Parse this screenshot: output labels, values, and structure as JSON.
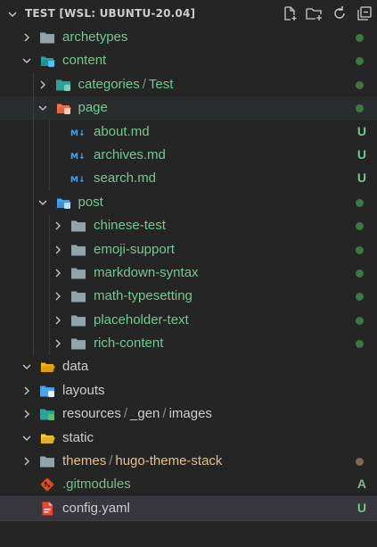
{
  "header": {
    "title": "TEST [WSL: UBUNTU-20.04]",
    "actions": [
      "new-file-icon",
      "new-folder-icon",
      "refresh-icon",
      "collapse-all-icon"
    ]
  },
  "colors": {
    "background": "#252526",
    "git_clean_dot": "#3b7a3f",
    "git_modified_dot": "#7d6a4f",
    "untracked_text": "#73c991",
    "added_badge": "#81b88b",
    "selected_row": "#37373d"
  },
  "tree": [
    {
      "label": "archetypes",
      "kind": "folder",
      "icon": "folder-icon",
      "depth": 0,
      "expanded": false,
      "status": "clean-dot"
    },
    {
      "label": "content",
      "kind": "folder",
      "icon": "folder-content-icon",
      "depth": 0,
      "expanded": true,
      "status": "clean-dot"
    },
    {
      "label": "categories",
      "label2": "Test",
      "kind": "folder",
      "icon": "folder-categories-icon",
      "depth": 1,
      "expanded": false,
      "status": "clean-dot"
    },
    {
      "label": "page",
      "kind": "folder",
      "icon": "folder-page-icon",
      "depth": 1,
      "expanded": true,
      "status": "clean-dot",
      "highlight": true
    },
    {
      "label": "about.md",
      "kind": "file",
      "icon": "markdown-icon",
      "depth": 2,
      "status": "U"
    },
    {
      "label": "archives.md",
      "kind": "file",
      "icon": "markdown-icon",
      "depth": 2,
      "status": "U"
    },
    {
      "label": "search.md",
      "kind": "file",
      "icon": "markdown-icon",
      "depth": 2,
      "status": "U"
    },
    {
      "label": "post",
      "kind": "folder",
      "icon": "folder-post-icon",
      "depth": 1,
      "expanded": true,
      "status": "clean-dot"
    },
    {
      "label": "chinese-test",
      "kind": "folder",
      "icon": "folder-icon",
      "depth": 2,
      "expanded": false,
      "status": "clean-dot"
    },
    {
      "label": "emoji-support",
      "kind": "folder",
      "icon": "folder-icon",
      "depth": 2,
      "expanded": false,
      "status": "clean-dot"
    },
    {
      "label": "markdown-syntax",
      "kind": "folder",
      "icon": "folder-icon",
      "depth": 2,
      "expanded": false,
      "status": "clean-dot"
    },
    {
      "label": "math-typesetting",
      "kind": "folder",
      "icon": "folder-icon",
      "depth": 2,
      "expanded": false,
      "status": "clean-dot"
    },
    {
      "label": "placeholder-text",
      "kind": "folder",
      "icon": "folder-icon",
      "depth": 2,
      "expanded": false,
      "status": "clean-dot"
    },
    {
      "label": "rich-content",
      "kind": "folder",
      "icon": "folder-icon",
      "depth": 2,
      "expanded": false,
      "status": "clean-dot"
    },
    {
      "label": "data",
      "kind": "folder",
      "icon": "folder-data-icon",
      "depth": 0,
      "expanded": true,
      "status": ""
    },
    {
      "label": "layouts",
      "kind": "folder",
      "icon": "folder-layouts-icon",
      "depth": 0,
      "expanded": false,
      "status": ""
    },
    {
      "label": "resources",
      "label2": "_gen",
      "label3": "images",
      "kind": "folder",
      "icon": "folder-images-icon",
      "depth": 0,
      "expanded": false,
      "status": ""
    },
    {
      "label": "static",
      "kind": "folder",
      "icon": "folder-static-icon",
      "depth": 0,
      "expanded": true,
      "status": ""
    },
    {
      "label": "themes",
      "label2": "hugo-theme-stack",
      "kind": "folder",
      "icon": "folder-themes-icon",
      "depth": 0,
      "expanded": false,
      "status": "modified-dot"
    },
    {
      "label": ".gitmodules",
      "kind": "file",
      "icon": "git-icon",
      "depth": 0,
      "status": "A"
    },
    {
      "label": "config.yaml",
      "kind": "file",
      "icon": "yaml-icon",
      "depth": 0,
      "status": "U",
      "selected": true
    }
  ]
}
